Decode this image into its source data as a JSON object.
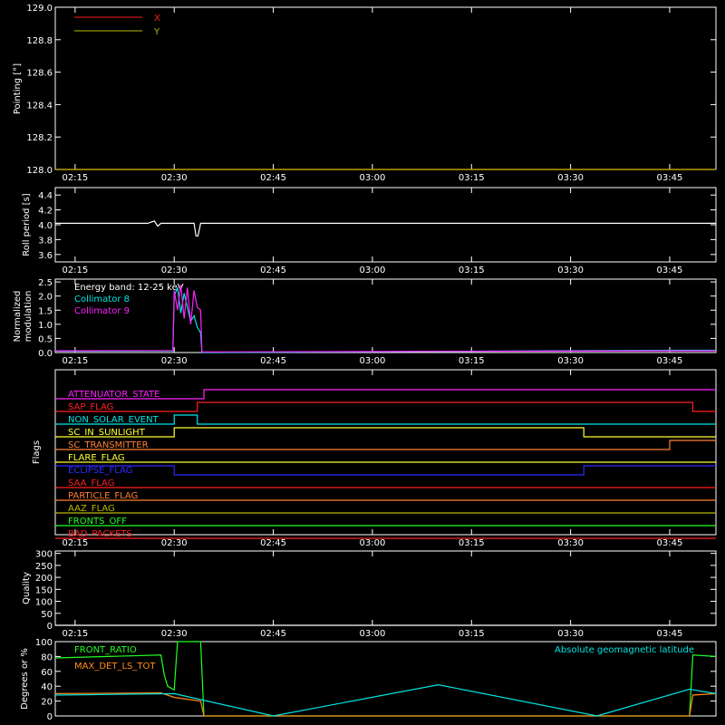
{
  "time_ticks": [
    "02:15",
    "02:30",
    "02:45",
    "03:00",
    "03:15",
    "03:30",
    "03:45"
  ],
  "colors": {
    "background": "#000000",
    "axes": "#ffffff",
    "red": "#ff2020",
    "olive": "#b8b800",
    "cyan": "#00e5e5",
    "magenta": "#ff22ff",
    "green": "#22ff22",
    "orange": "#ff8c1a",
    "yellow": "#ffff33",
    "blue": "#2a2aff",
    "flag_orange": "#ff7f33",
    "brown": "#c0a050"
  },
  "chart_data": [
    {
      "type": "line",
      "panel": "pointing",
      "ylabel": "Pointing [°]",
      "ylim": [
        128.0,
        129.0
      ],
      "yticks": [
        "129.0",
        "128.8",
        "128.6",
        "128.4",
        "128.2",
        "128.0"
      ],
      "series": [
        {
          "name": "X",
          "color": "#ff2020",
          "x": [
            "02:12",
            "03:52"
          ],
          "values": [
            128.0,
            128.0
          ]
        },
        {
          "name": "Y",
          "color": "#b8b800",
          "x": [
            "02:12",
            "03:52"
          ],
          "values": [
            128.0,
            128.0
          ]
        }
      ]
    },
    {
      "type": "line",
      "panel": "roll",
      "ylabel": "Roll period [s]",
      "ylim": [
        3.5,
        4.5
      ],
      "yticks": [
        "4.4",
        "4.2",
        "4.0",
        "3.8",
        "3.6"
      ],
      "series": [
        {
          "color": "#ffffff",
          "x": [
            "02:12",
            "02:26",
            "02:27",
            "02:27.5",
            "02:28",
            "02:33",
            "02:33.3",
            "02:33.6",
            "02:34",
            "03:52"
          ],
          "values": [
            4.02,
            4.02,
            4.05,
            3.98,
            4.02,
            4.02,
            3.85,
            3.85,
            4.02,
            4.02
          ]
        }
      ]
    },
    {
      "type": "line",
      "panel": "modulation",
      "ylabel": "Normalized modulation",
      "ylim": [
        0,
        2.6
      ],
      "yticks": [
        "2.5",
        "2.0",
        "1.5",
        "1.0",
        "0.5",
        "0.0"
      ],
      "annotation": "Energy band: 12-25 keV",
      "series": [
        {
          "name": "Collimator 8",
          "color": "#00e5e5",
          "x": [
            "02:12",
            "02:29.8",
            "02:30",
            "02:30.5",
            "02:31",
            "02:31.5",
            "02:32",
            "02:32.5",
            "02:33",
            "02:33.5",
            "02:34",
            "02:34.2",
            "03:46",
            "03:52"
          ],
          "values": [
            0.05,
            0.06,
            2.0,
            2.3,
            1.4,
            2.1,
            1.6,
            1.1,
            1.3,
            0.9,
            0.7,
            0.0,
            0.08,
            0.08
          ]
        },
        {
          "name": "Collimator 9",
          "color": "#ff22ff",
          "x": [
            "02:12",
            "02:29.8",
            "02:30",
            "02:30.5",
            "02:31",
            "02:31.5",
            "02:32",
            "02:32.5",
            "02:33",
            "02:33.5",
            "02:34",
            "02:34.2",
            "03:46",
            "03:52"
          ],
          "values": [
            0.06,
            0.07,
            2.2,
            1.5,
            2.4,
            1.2,
            2.3,
            1.0,
            2.2,
            1.6,
            1.5,
            0.02,
            0.06,
            0.06
          ]
        }
      ]
    },
    {
      "type": "line",
      "panel": "flags",
      "ylabel": "Flags",
      "flags": [
        {
          "name": "ATTENUATOR_STATE",
          "color": "#ff22ff",
          "steps": [
            [
              "02:12",
              0
            ],
            [
              "02:34.5",
              1
            ]
          ]
        },
        {
          "name": "SAP_FLAG",
          "color": "#ff2020",
          "steps": [
            [
              "02:12",
              0
            ],
            [
              "02:33.5",
              1
            ],
            [
              "03:48.5",
              0
            ]
          ]
        },
        {
          "name": "NON_SOLAR_EVENT",
          "color": "#00e5e5",
          "steps": [
            [
              "02:12",
              0
            ],
            [
              "02:30",
              1
            ],
            [
              "02:33.5",
              0
            ]
          ]
        },
        {
          "name": "SC_IN_SUNLIGHT",
          "color": "#ffff33",
          "steps": [
            [
              "02:12",
              0
            ],
            [
              "02:30",
              1
            ],
            [
              "03:32",
              0
            ]
          ]
        },
        {
          "name": "SC_TRANSMITTER",
          "color": "#ff7f33",
          "steps": [
            [
              "02:12",
              0
            ],
            [
              "03:45",
              1
            ]
          ]
        },
        {
          "name": "FLARE_FLAG",
          "color": "#ffff33",
          "steps": [
            [
              "02:12",
              0
            ]
          ]
        },
        {
          "name": "ECLIPSE_FLAG",
          "color": "#2a2aff",
          "steps": [
            [
              "02:12",
              1
            ],
            [
              "02:30",
              0
            ],
            [
              "03:32",
              1
            ]
          ]
        },
        {
          "name": "SAA_FLAG",
          "color": "#ff2020",
          "steps": [
            [
              "02:12",
              0
            ]
          ]
        },
        {
          "name": "PARTICLE_FLAG",
          "color": "#ff7f33",
          "steps": [
            [
              "02:12",
              0
            ]
          ]
        },
        {
          "name": "AAZ_FLAG",
          "color": "#b8b800",
          "steps": [
            [
              "02:12",
              0
            ]
          ]
        },
        {
          "name": "FRONTS_OFF",
          "color": "#22ff22",
          "steps": [
            [
              "02:12",
              0
            ]
          ]
        },
        {
          "name": "BAD_PACKETS",
          "color": "#ff2020",
          "steps": [
            [
              "02:12",
              0
            ]
          ]
        }
      ]
    },
    {
      "type": "line",
      "panel": "quality",
      "ylabel": "Quality",
      "ylim": [
        0,
        310
      ],
      "yticks": [
        "300",
        "250",
        "200",
        "150",
        "100",
        "50",
        "0"
      ],
      "series": [
        {
          "color": "#ffffff",
          "x": [
            "02:12",
            "03:52"
          ],
          "values": [
            0,
            0
          ]
        }
      ]
    },
    {
      "type": "line",
      "panel": "status",
      "ylabel": "Degrees or %",
      "ylim": [
        0,
        100
      ],
      "yticks": [
        "100",
        "80",
        "60",
        "40",
        "20",
        "0"
      ],
      "series": [
        {
          "name": "FRONT_RATIO",
          "color": "#22ff22",
          "x": [
            "02:12",
            "02:28",
            "02:28.5",
            "02:29",
            "02:30",
            "02:30.5",
            "02:34",
            "02:34.5",
            "03:48",
            "03:48.5",
            "03:52"
          ],
          "values": [
            78,
            82,
            55,
            40,
            35,
            100,
            100,
            0,
            0,
            82,
            80
          ]
        },
        {
          "name": "MAX_DET_LS_TOT",
          "color": "#ff8c1a",
          "x": [
            "02:12",
            "02:28",
            "02:29",
            "02:30",
            "02:34",
            "02:34.5",
            "03:48",
            "03:48.5",
            "03:52"
          ],
          "values": [
            30,
            31,
            28,
            25,
            20,
            0,
            0,
            28,
            30
          ]
        },
        {
          "name": "Absolute geomagnetic latitude",
          "color": "#00e5e5",
          "x": [
            "02:12",
            "02:30",
            "02:45",
            "03:10",
            "03:34",
            "03:48",
            "03:52"
          ],
          "values": [
            28,
            30,
            0,
            42,
            0,
            36,
            30
          ]
        }
      ]
    }
  ]
}
